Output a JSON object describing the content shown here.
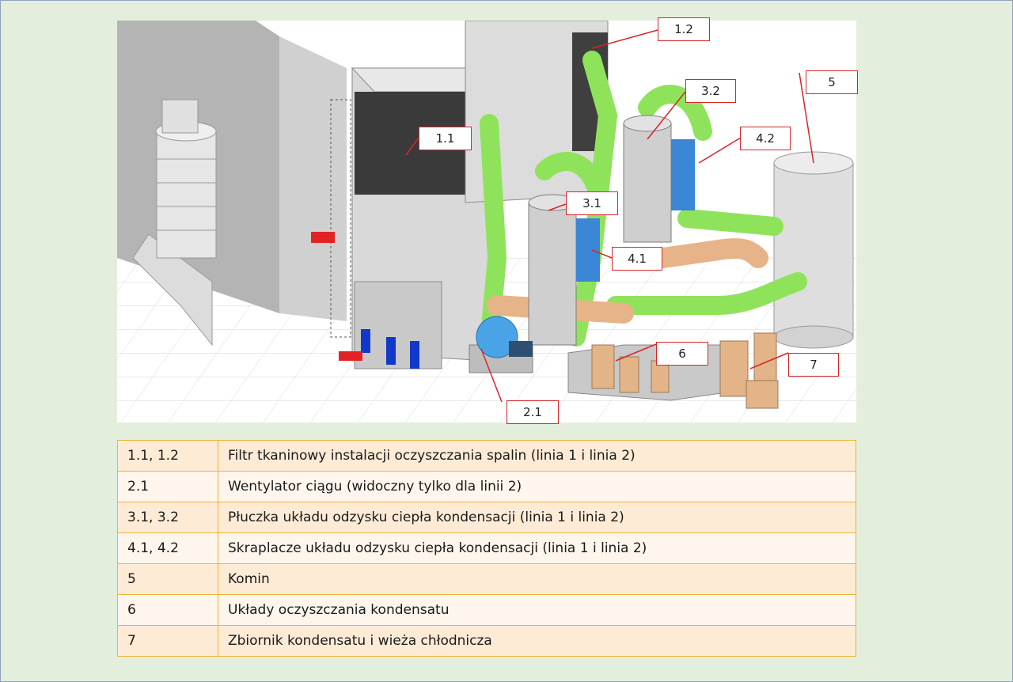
{
  "colors": {
    "callout_border": "#d7262a",
    "ducts": "#8fe35a",
    "ducts_warm": "#e7b48a",
    "legend_border": "#f0b23a",
    "legend_fill": "#fdebd6",
    "background": "#e3efdc"
  },
  "callouts": [
    {
      "id": "1.1",
      "label": "1.1"
    },
    {
      "id": "1.2",
      "label": "1.2"
    },
    {
      "id": "2.1",
      "label": "2.1"
    },
    {
      "id": "3.1",
      "label": "3.1"
    },
    {
      "id": "3.2",
      "label": "3.2"
    },
    {
      "id": "4.1",
      "label": "4.1"
    },
    {
      "id": "4.2",
      "label": "4.2"
    },
    {
      "id": "5",
      "label": "5"
    },
    {
      "id": "6",
      "label": "6"
    },
    {
      "id": "7",
      "label": "7"
    }
  ],
  "legend": [
    {
      "key": "1.1, 1.2",
      "description": "Filtr tkaninowy instalacji oczyszczania spalin (linia 1 i linia 2)"
    },
    {
      "key": "2.1",
      "description": "Wentylator ciągu (widoczny tylko dla linii 2)"
    },
    {
      "key": "3.1, 3.2",
      "description": "Płuczka układu odzysku ciepła kondensacji (linia 1 i linia 2)"
    },
    {
      "key": "4.1, 4.2",
      "description": "Skraplacze układu odzysku ciepła kondensacji (linia 1 i linia 2)"
    },
    {
      "key": "5",
      "description": "Komin"
    },
    {
      "key": "6",
      "description": "Układy oczyszczania kondensatu"
    },
    {
      "key": "7",
      "description": "Zbiornik kondensatu i wieża chłodnicza"
    }
  ]
}
